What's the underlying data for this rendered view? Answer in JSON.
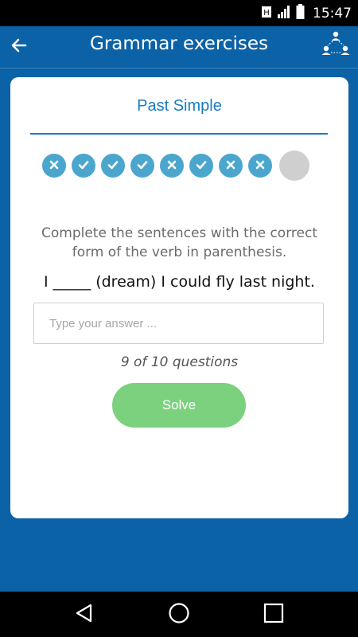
{
  "status_bar": {
    "time": "15:47"
  },
  "toolbar": {
    "title": "Grammar exercises",
    "back_icon": "back-arrow-icon",
    "people_icon": "people-network-icon"
  },
  "card": {
    "title": "Past Simple",
    "progress": [
      {
        "status": "wrong"
      },
      {
        "status": "correct"
      },
      {
        "status": "correct"
      },
      {
        "status": "correct"
      },
      {
        "status": "wrong"
      },
      {
        "status": "correct"
      },
      {
        "status": "wrong"
      },
      {
        "status": "wrong"
      },
      {
        "status": "pending"
      }
    ],
    "instruction": "Complete the sentences with the correct form of the verb in parenthesis.",
    "sentence": "I _____ (dream) I could fly last night.",
    "answer_input": {
      "placeholder": "Type your answer ...",
      "value": ""
    },
    "counter": "9 of 10 questions",
    "solve_label": "Solve"
  },
  "colors": {
    "primary": "#0b62a6",
    "accent": "#1a7cc0",
    "dot": "#4ba6cd",
    "pending": "#cfcfcf",
    "solve": "#7cd17e"
  }
}
